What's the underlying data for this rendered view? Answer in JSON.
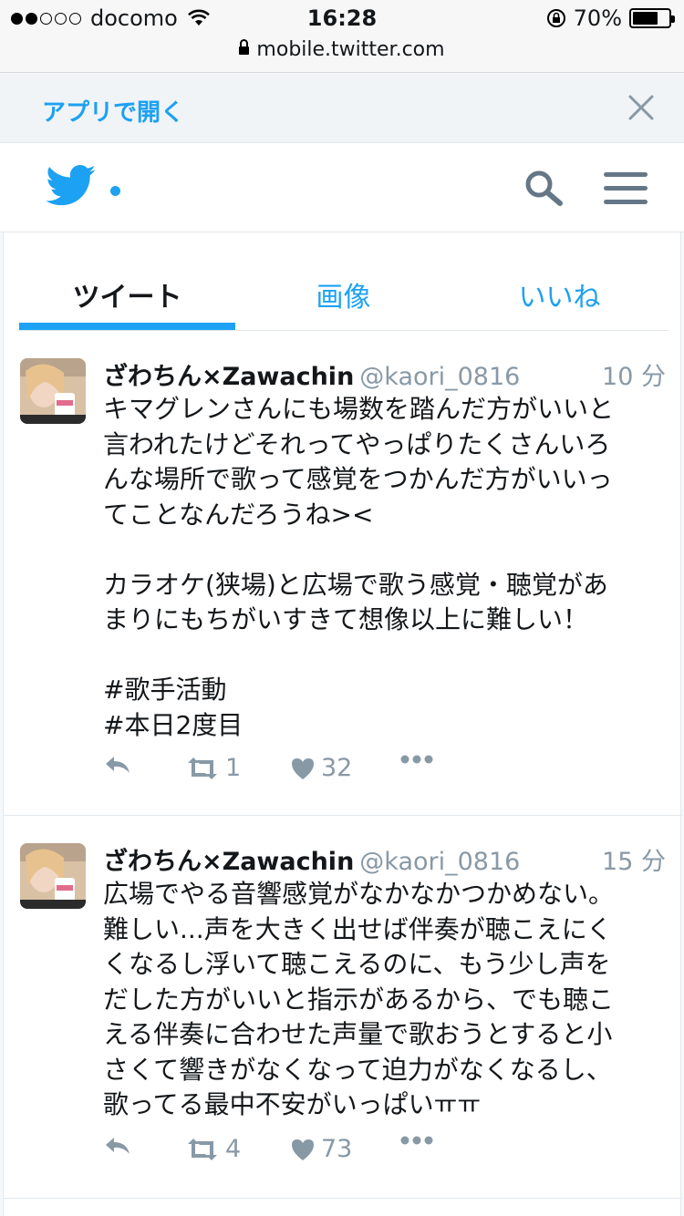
{
  "status_bar": {
    "carrier": "docomo",
    "signal_level": 2,
    "time": "16:28",
    "battery": "70%",
    "battery_fraction": 0.7
  },
  "url_bar": {
    "url": "mobile.twitter.com"
  },
  "app_banner": {
    "open_label": "アプリで開く",
    "close_icon": "close-icon"
  },
  "header": {
    "logo_icon": "twitter-bird-icon",
    "search_icon": "search-icon",
    "menu_icon": "hamburger-menu-icon"
  },
  "tabs": [
    {
      "label": "ツイート",
      "active": true
    },
    {
      "label": "画像",
      "active": false
    },
    {
      "label": "いいね",
      "active": false
    }
  ],
  "tweets": [
    {
      "name": "ざわちん×Zawachin",
      "handle": "@kaori_0816",
      "time": "10 分",
      "text": "キマグレンさんにも場数を踏んだ方がいいと\n言われたけどそれってやっぱりたくさんいろ\nんな場所で歌って感覚をつかんだ方がいいっ\nてことなんだろうね><\n\nカラオケ(狭場)と広場で歌う感覚・聴覚があ\nまりにもちがいすきて想像以上に難しい！\n\n#歌手活動\n#本日2度目",
      "retweets": "1",
      "likes": "32"
    },
    {
      "name": "ざわちん×Zawachin",
      "handle": "@kaori_0816",
      "time": "15 分",
      "text": "広場でやる音響感覚がなかなかつかめない。\n難しい...声を大きく出せば伴奏が聴こえにく\nくなるし浮いて聴こえるのに、もう少し声を\nだした方がいいと指示があるから、でも聴こ\nえる伴奏に合わせた声量で歌おうとすると小\nさくて響きがなくなって迫力がなくなるし、\n歌ってる最中不安がいっぱいㅠㅠ",
      "retweets": "4",
      "likes": "73"
    }
  ],
  "colors": {
    "accent": "#1da1f2",
    "muted": "#8899a6",
    "text": "#14171a"
  }
}
